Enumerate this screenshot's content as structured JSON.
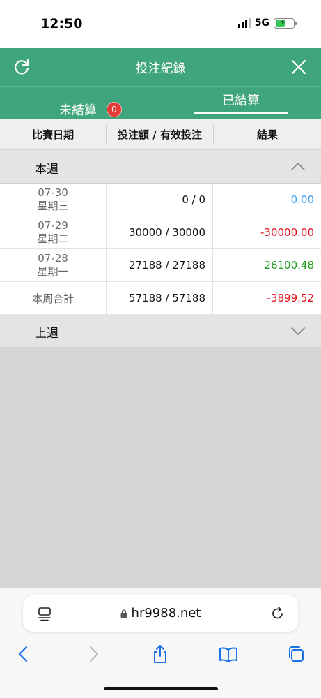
{
  "status_bar": {
    "time": "12:50",
    "network": "5G",
    "battery_color": "#33c759"
  },
  "header": {
    "title": "投注紀錄",
    "refresh_icon": "refresh-icon",
    "close_icon": "close-icon",
    "bg_color": "#3fa57c"
  },
  "tabs": {
    "unsettled_label": "未結算",
    "unsettled_count": "0",
    "settled_label": "已結算",
    "active": "settled"
  },
  "table": {
    "columns": [
      "比賽日期",
      "投注額 / 有效投注",
      "結果"
    ]
  },
  "this_week": {
    "label": "本週",
    "expanded": true,
    "rows": [
      {
        "date": "07-30",
        "weekday": "星期三",
        "amount": "0 / 0",
        "result": "0.00",
        "result_color": "#3a9ff5"
      },
      {
        "date": "07-29",
        "weekday": "星期二",
        "amount": "30000 / 30000",
        "result": "-30000.00",
        "result_color": "#e8101a"
      },
      {
        "date": "07-28",
        "weekday": "星期一",
        "amount": "27188 / 27188",
        "result": "26100.48",
        "result_color": "#1a9a1a"
      }
    ],
    "total": {
      "label": "本周合計",
      "amount": "57188 / 57188",
      "result": "-3899.52",
      "result_color": "#e8101a"
    }
  },
  "last_week": {
    "label": "上週",
    "expanded": false
  },
  "browser": {
    "url": "hr9988.net"
  }
}
